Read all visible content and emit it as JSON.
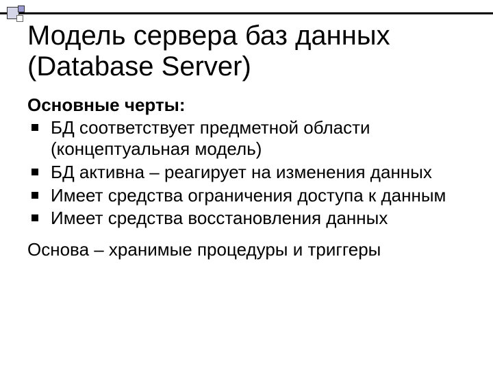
{
  "title": "Модель сервера баз данных (Database Server)",
  "subhead": "Основные черты:",
  "bullets": [
    "БД соответствует предметной области (концептуальная модель)",
    "БД активна – реагирует на изменения данных",
    "Имеет средства ограничения доступа к данным",
    "Имеет средства восстановления данных"
  ],
  "footer": "Основа – хранимые процедуры и триггеры"
}
